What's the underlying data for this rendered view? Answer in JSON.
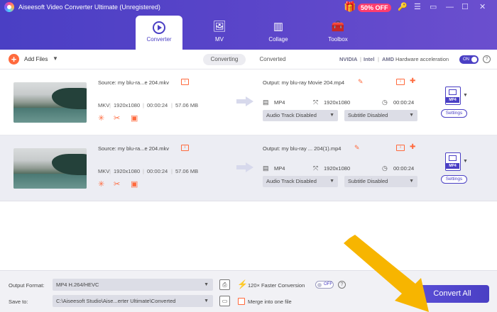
{
  "window": {
    "title": "Aiseesoft Video Converter Ultimate (Unregistered)",
    "promo_badge": "50% OFF",
    "controls": [
      "🔑",
      "☰",
      "▭",
      "—",
      "☐",
      "✕"
    ]
  },
  "nav": {
    "tabs": [
      {
        "label": "Converter",
        "icon": "converter-icon",
        "active": true
      },
      {
        "label": "MV",
        "icon": "mv-icon",
        "active": false
      },
      {
        "label": "Collage",
        "icon": "collage-icon",
        "active": false
      },
      {
        "label": "Toolbox",
        "icon": "toolbox-icon",
        "active": false
      }
    ]
  },
  "toolbar": {
    "add_files": "Add Files",
    "sub_tabs": [
      "Converting",
      "Converted"
    ],
    "hw": {
      "nvidia": "NVIDIA",
      "intel": "Intel",
      "amd": "AMD",
      "label": "Hardware acceleration",
      "toggle": "ON"
    }
  },
  "files": [
    {
      "source": "Source: my blu-ra...e 204.mkv",
      "format": "MKV",
      "resolution": "1920x1080",
      "duration": "00:00:24",
      "size": "57.06 MB",
      "output": "Output: my blu-ray Movie 204.mp4",
      "out_format": "MP4",
      "out_resolution": "1920x1080",
      "out_duration": "00:00:24",
      "audio": "Audio Track Disabled",
      "subtitle": "Subtitle Disabled",
      "format_badge": "MP4",
      "settings": "Settings"
    },
    {
      "source": "Source: my blu-ra...e 204.mkv",
      "format": "MKV",
      "resolution": "1920x1080",
      "duration": "00:00:24",
      "size": "57.06 MB",
      "output": "Output: my blu-ray ... 204(1).mp4",
      "out_format": "MP4",
      "out_resolution": "1920x1080",
      "out_duration": "00:00:24",
      "audio": "Audio Track Disabled",
      "subtitle": "Subtitle Disabled",
      "format_badge": "MP4",
      "settings": "Settings"
    }
  ],
  "footer": {
    "output_format_label": "Output Format:",
    "output_format_value": "MP4 H.264/HEVC",
    "save_to_label": "Save to:",
    "save_to_value": "C:\\Aiseesoft Studio\\Aise...erter Ultimate\\Converted",
    "faster": "120× Faster Conversion",
    "faster_toggle": "OFF",
    "merge": "Merge into one file",
    "convert_all": "Convert All"
  },
  "colors": {
    "accent": "#4a3fc4",
    "orange": "#ff6a3d",
    "annotation": "#f7b500"
  }
}
